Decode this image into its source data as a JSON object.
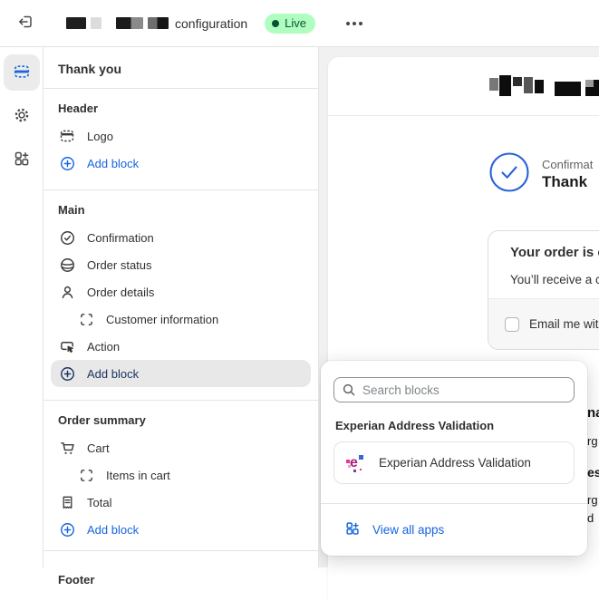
{
  "topbar": {
    "title": "configuration",
    "live_badge": "Live"
  },
  "sidebar": {
    "title": "Thank you",
    "sections": [
      {
        "heading": "Header",
        "items": [
          {
            "label": "Logo"
          },
          {
            "label": "Add block"
          }
        ]
      },
      {
        "heading": "Main",
        "items": [
          {
            "label": "Confirmation"
          },
          {
            "label": "Order status"
          },
          {
            "label": "Order details"
          },
          {
            "label": "Customer information"
          },
          {
            "label": "Action"
          },
          {
            "label": "Add block"
          }
        ]
      },
      {
        "heading": "Order summary",
        "items": [
          {
            "label": "Cart"
          },
          {
            "label": "Items in cart"
          },
          {
            "label": "Total"
          },
          {
            "label": "Add block"
          }
        ]
      },
      {
        "heading": "Footer",
        "items": []
      }
    ]
  },
  "preview": {
    "confirmation_kicker": "Confirmat",
    "confirmation_title": "Thank",
    "order_card": {
      "title": "Your order is c",
      "body": "You’ll receive a c",
      "checkbox_label": "Email me wit"
    },
    "clipped_fragments": [
      "na",
      "rg",
      "es",
      "rg",
      "d"
    ]
  },
  "popover": {
    "search_placeholder": "Search blocks",
    "group_heading": "Experian Address Validation",
    "app_name": "Experian Address Validation",
    "view_all_label": "View all apps"
  },
  "colors": {
    "accent_blue": "#1766e0",
    "selected_navy": "#1c3560",
    "live_bg": "#affebf",
    "live_text": "#0c5132",
    "preview_check_blue": "#2a62d8"
  }
}
